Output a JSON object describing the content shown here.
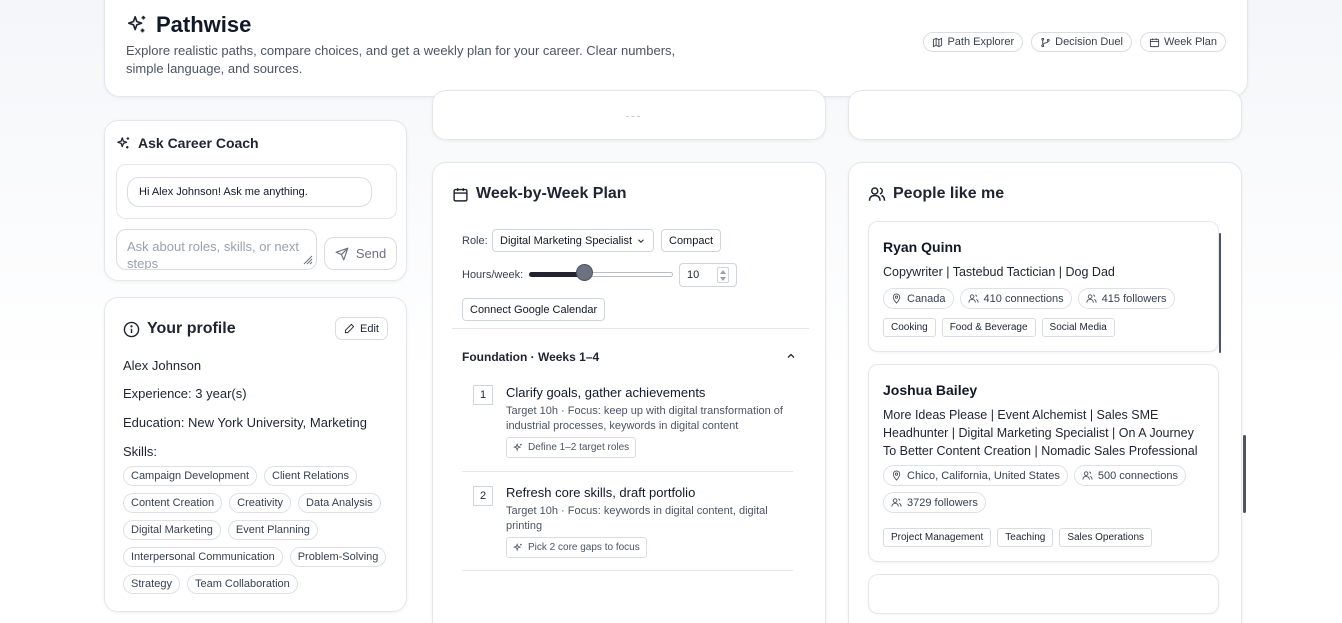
{
  "header": {
    "title": "Pathwise",
    "description": "Explore realistic paths, compare choices, and get a weekly plan for your career. Clear numbers, simple language, and sources.",
    "nav": [
      {
        "label": "Path Explorer",
        "icon": "map-icon"
      },
      {
        "label": "Decision Duel",
        "icon": "branch-icon"
      },
      {
        "label": "Week Plan",
        "icon": "calendar-icon"
      }
    ]
  },
  "coach": {
    "title": "Ask Career Coach",
    "greeting": "Hi Alex Johnson! Ask me anything.",
    "input_placeholder": "Ask about roles, skills, or next steps",
    "send_label": "Send"
  },
  "profile": {
    "title": "Your profile",
    "edit_label": "Edit",
    "name": "Alex Johnson",
    "experience": "Experience: 3 year(s)",
    "education": "Education: New York University, Marketing",
    "skills_label": "Skills:",
    "skills": [
      "Campaign Development",
      "Client Relations",
      "Content Creation",
      "Creativity",
      "Data Analysis",
      "Digital Marketing",
      "Event Planning",
      "Interpersonal Communication",
      "Problem-Solving",
      "Strategy",
      "Team Collaboration"
    ]
  },
  "plan": {
    "title": "Week-by-Week Plan",
    "role_label": "Role:",
    "role_value": "Digital Marketing Specialist",
    "compact_label": "Compact",
    "hours_label": "Hours/week:",
    "hours_value": "10",
    "hours_fraction": 0.38,
    "calendar_label": "Connect Google Calendar",
    "phase_title": "Foundation · Weeks 1–4",
    "weeks": [
      {
        "num": "1",
        "title": "Clarify goals, gather achievements",
        "desc": "Target 10h · Focus: keep up with digital transformation of industrial processes, keywords in digital content",
        "tag": "Define 1–2 target roles"
      },
      {
        "num": "2",
        "title": "Refresh core skills, draft portfolio",
        "desc": "Target 10h · Focus: keywords in digital content, digital printing",
        "tag": "Pick 2 core gaps to focus"
      }
    ]
  },
  "people": {
    "title": "People like me",
    "list": [
      {
        "name": "Ryan Quinn",
        "headline": "Copywriter | Tastebud Tactician | Dog Dad",
        "location": "Canada",
        "connections": "410 connections",
        "followers": "415 followers",
        "tags": [
          "Cooking",
          "Food & Beverage",
          "Social Media"
        ]
      },
      {
        "name": "Joshua Bailey",
        "headline": "More Ideas Please | Event Alchemist | Sales SME Headhunter | Digital Marketing Specialist | On A Journey To Better Content Creation | Nomadic Sales Professional",
        "location": "Chico, California, United States",
        "connections": "500 connections",
        "followers": "3729 followers",
        "tags": [
          "Project Management",
          "Teaching",
          "Sales Operations"
        ]
      }
    ]
  }
}
